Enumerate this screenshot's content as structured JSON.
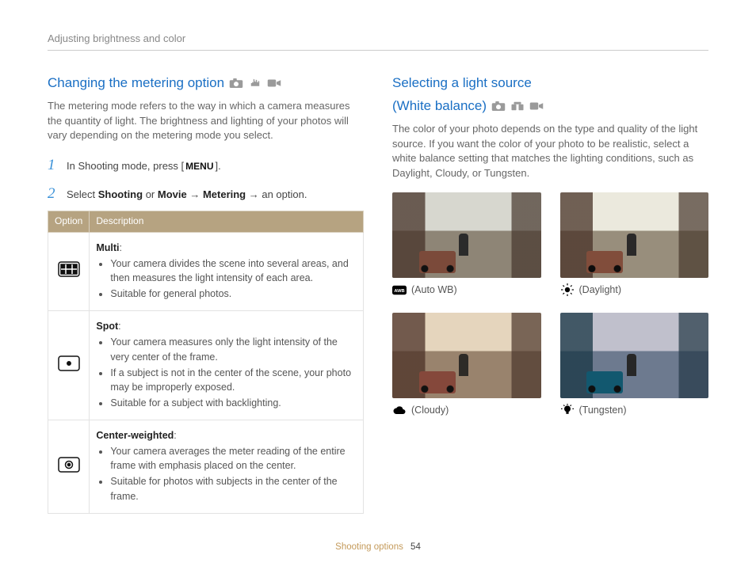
{
  "breadcrumb": "Adjusting brightness and color",
  "left": {
    "heading": "Changing the metering option",
    "intro": "The metering mode refers to the way in which a camera measures the quantity of light. The brightness and lighting of your photos will vary depending on the metering mode you select.",
    "step1_pre": "In Shooting mode, press [",
    "step1_btn": "MENU",
    "step1_post": "].",
    "step2_pre": "Select ",
    "step2_b1": "Shooting",
    "step2_or": " or ",
    "step2_b2": "Movie",
    "step2_arrow1": " → ",
    "step2_b3": "Metering",
    "step2_arrow2": " → an option.",
    "table": {
      "th_option": "Option",
      "th_desc": "Description",
      "rows": [
        {
          "label": "Multi",
          "points": [
            "Your camera divides the scene into several areas, and then measures the light intensity of each area.",
            "Suitable for general photos."
          ]
        },
        {
          "label": "Spot",
          "points": [
            "Your camera measures only the light intensity of the very center of the frame.",
            "If a subject is not in the center of the scene, your photo may be improperly exposed.",
            "Suitable for a subject with backlighting."
          ]
        },
        {
          "label": "Center-weighted",
          "points": [
            "Your camera averages the meter reading of the entire frame with emphasis placed on the center.",
            "Suitable for photos with subjects in the center of the frame."
          ]
        }
      ]
    }
  },
  "right": {
    "heading_l1": "Selecting a light source",
    "heading_l2": "(White balance)",
    "intro": "The color of your photo depends on the type and quality of the light source. If you want the color of your photo to be realistic, select a white balance setting that matches the lighting conditions, such as Daylight, Cloudy, or Tungsten.",
    "wb": [
      {
        "label": "(Auto WB)"
      },
      {
        "label": "(Daylight)"
      },
      {
        "label": "(Cloudy)"
      },
      {
        "label": "(Tungsten)"
      }
    ]
  },
  "footer": {
    "section": "Shooting options",
    "page": "54"
  }
}
